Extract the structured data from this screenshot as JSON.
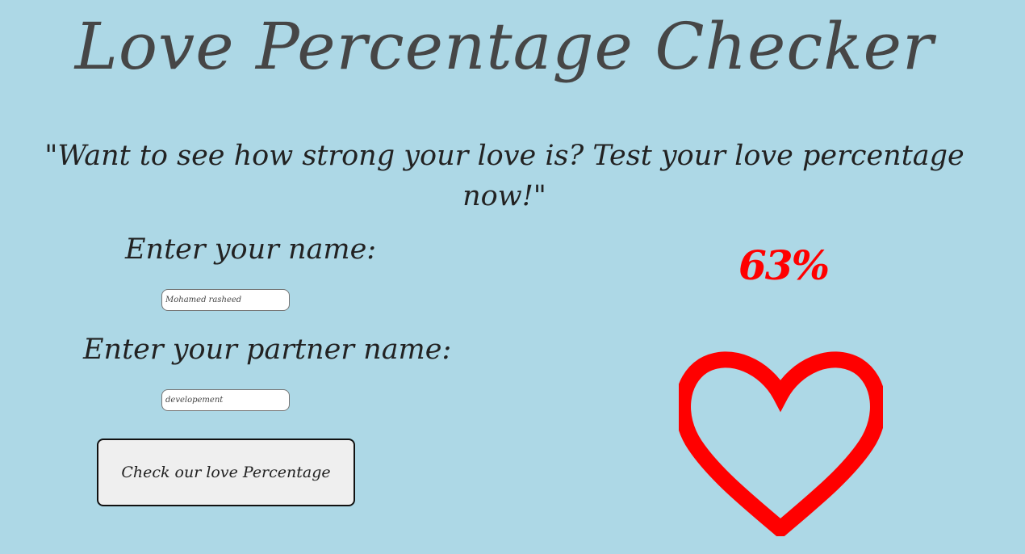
{
  "header": {
    "title": "Love Percentage Checker",
    "tagline": "\"Want to see how strong your love is? Test your love percentage now!\""
  },
  "form": {
    "name_label": "Enter your name:",
    "name_value": "Mohamed rasheed",
    "partner_label": "Enter your partner name:",
    "partner_value": "developement",
    "submit_label": "Check our love Percentage"
  },
  "result": {
    "percentage_text": "63%",
    "heart_icon": "heart-outline-icon",
    "accent_color": "#ff0000"
  },
  "theme": {
    "background": "#add8e6"
  }
}
